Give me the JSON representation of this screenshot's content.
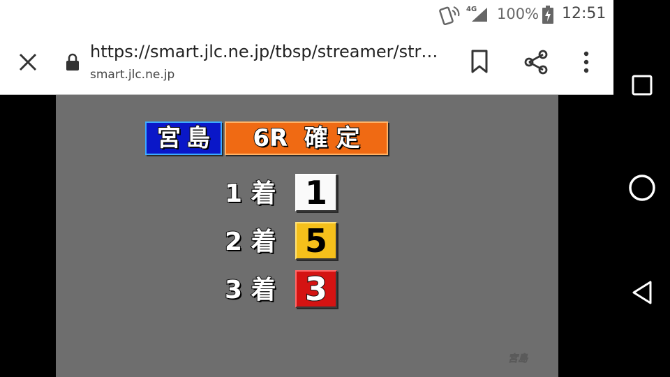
{
  "status_bar": {
    "network": "4G",
    "battery": "100%",
    "time": "12:51"
  },
  "browser": {
    "url": "https://smart.jlc.ne.jp/tbsp/streamer/str…",
    "domain": "smart.jlc.ne.jp",
    "icons": [
      "close-icon",
      "lock-icon",
      "bookmark-icon",
      "share-icon",
      "more-vert-icon"
    ]
  },
  "nav": {
    "icons": [
      "recents-icon",
      "home-icon",
      "back-icon"
    ]
  },
  "broadcast": {
    "venue": "宮島",
    "race_status": "6R  確 定",
    "results": [
      {
        "place": "1 着",
        "boat": "1",
        "color": "#fafafa"
      },
      {
        "place": "2 着",
        "boat": "5",
        "color": "#f5c01b"
      },
      {
        "place": "3 着",
        "boat": "3",
        "color": "#d41312"
      }
    ],
    "watermark": "宮島"
  },
  "colors": {
    "venue_bg": "#0a17c8",
    "race_bg": "#f06a13",
    "video_bg": "#6e6e6e"
  }
}
